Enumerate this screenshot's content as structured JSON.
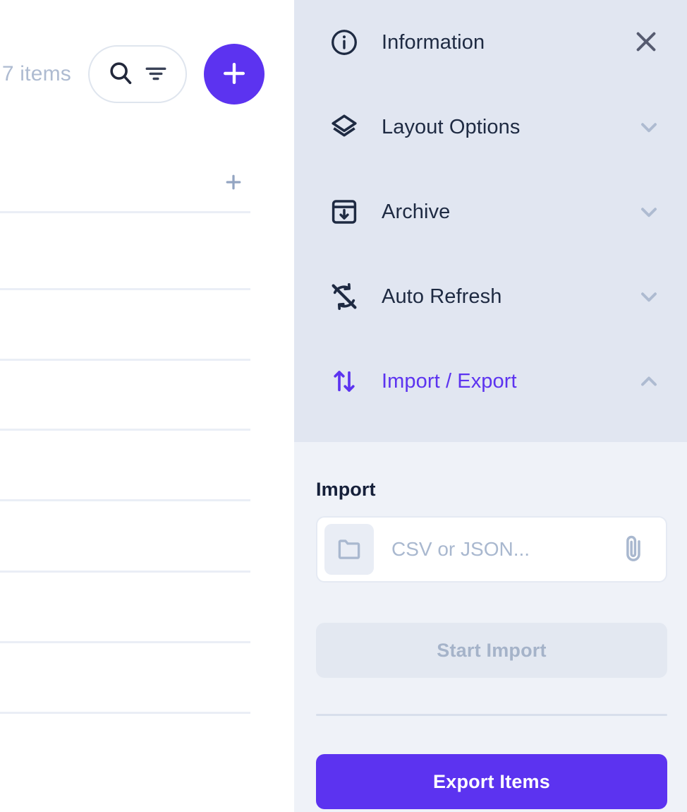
{
  "accent_color": "#5c33f0",
  "colors": {
    "panel_header_bg": "#e1e6f1",
    "panel_body_bg": "#eff2f8",
    "text_dark": "#1e2a42",
    "muted": "#a9b8cf",
    "chevron": "#aebbd1",
    "divider": "#eaeef6"
  },
  "left": {
    "items_count_text": "7 items",
    "search_icon": "search-icon",
    "filter_icon": "filter-icon",
    "add_icon": "plus-icon",
    "inline_add_icon": "plus-icon",
    "row_count": 8
  },
  "panel": {
    "close_icon": "close-icon",
    "sections": [
      {
        "id": "information",
        "label": "Information",
        "icon": "info-circle-icon",
        "expandable": false,
        "expanded": false,
        "active": false
      },
      {
        "id": "layout",
        "label": "Layout Options",
        "icon": "layers-icon",
        "expandable": true,
        "expanded": false,
        "active": false
      },
      {
        "id": "archive",
        "label": "Archive",
        "icon": "archive-box-icon",
        "expandable": true,
        "expanded": false,
        "active": false
      },
      {
        "id": "auto-refresh",
        "label": "Auto Refresh",
        "icon": "sync-disabled-icon",
        "expandable": true,
        "expanded": false,
        "active": false
      },
      {
        "id": "import-export",
        "label": "Import / Export",
        "icon": "import-export-arrows-icon",
        "expandable": true,
        "expanded": true,
        "active": true
      }
    ],
    "import": {
      "title": "Import",
      "folder_icon": "folder-icon",
      "attach_icon": "paperclip-icon",
      "file_placeholder": "CSV or JSON...",
      "file_value": "",
      "start_button_label": "Start Import",
      "start_button_disabled": true
    },
    "export": {
      "button_label": "Export Items"
    }
  }
}
